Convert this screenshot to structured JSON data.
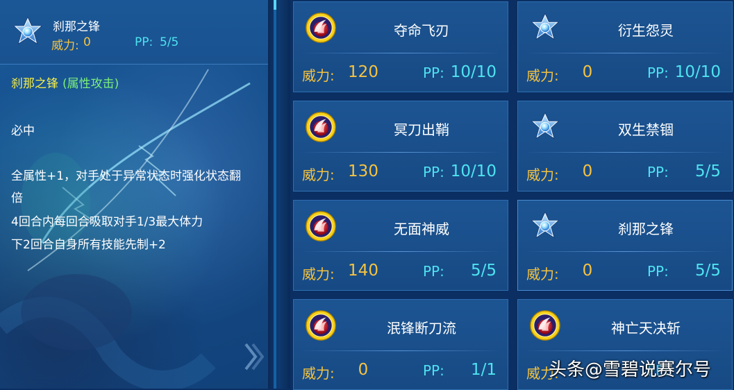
{
  "selected": {
    "name": "刹那之锋",
    "power_label": "威力:",
    "power": "0",
    "pp_label": "PP:",
    "pp": "5/5",
    "icon": "star-icon"
  },
  "description": {
    "title": "刹那之锋",
    "category": "(属性攻击)",
    "lines": [
      "必中",
      "全属性+1，对手处于异常状态时强化状态翻",
      "倍",
      "4回合内每回合吸取对手1/3最大体力",
      "下2回合自身所有技能先制+2"
    ]
  },
  "labels": {
    "power": "威力:",
    "pp": "PP:"
  },
  "skills": [
    {
      "name": "夺命飞刃",
      "power": "120",
      "pp": "10/10",
      "icon": "fire-attack-icon"
    },
    {
      "name": "衍生怨灵",
      "power": "0",
      "pp": "10/10",
      "icon": "star-icon"
    },
    {
      "name": "冥刀出鞘",
      "power": "130",
      "pp": "10/10",
      "icon": "fire-attack-icon"
    },
    {
      "name": "双生禁锢",
      "power": "0",
      "pp": "5/5",
      "icon": "star-icon"
    },
    {
      "name": "无面神威",
      "power": "140",
      "pp": "5/5",
      "icon": "fire-attack-icon"
    },
    {
      "name": "刹那之锋",
      "power": "0",
      "pp": "5/5",
      "icon": "star-icon"
    },
    {
      "name": "泯锋断刀流",
      "power": "0",
      "pp": "1/1",
      "icon": "fire-attack-icon"
    },
    {
      "name": "神亡天决斩",
      "power": "",
      "pp": "",
      "icon": "fire-attack-icon"
    }
  ],
  "watermark": "头条@雪碧说赛尔号",
  "colors": {
    "power": "#f5c341",
    "pp": "#4fe3f0",
    "title": "#f4ec4a",
    "category": "#7ef07a"
  }
}
